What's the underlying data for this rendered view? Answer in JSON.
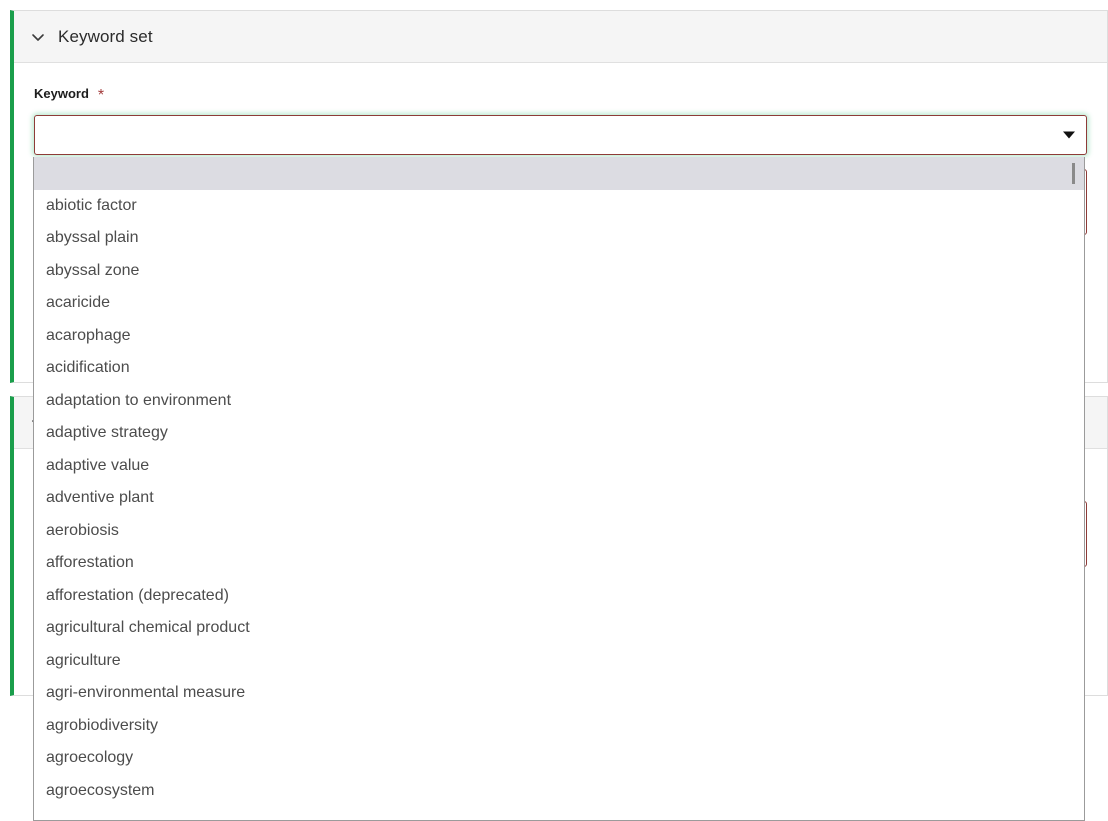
{
  "panels": [
    {
      "title": "Keyword set",
      "collapse_icon": "chevron-down-icon",
      "field": {
        "label": "Keyword",
        "required_marker": "*",
        "value": "",
        "placeholder": "",
        "dropdown_icon": "triangle-down-icon"
      }
    },
    {
      "title": "",
      "collapse_icon": "chevron-down-icon"
    }
  ],
  "dropdown": {
    "selected_index": 0,
    "options": [
      "",
      "abiotic factor",
      "abyssal plain",
      "abyssal zone",
      "acaricide",
      "acarophage",
      "acidification",
      "adaptation to environment",
      "adaptive strategy",
      "adaptive value",
      "adventive plant",
      "aerobiosis",
      "afforestation",
      "afforestation (deprecated)",
      "agricultural chemical product",
      "agriculture",
      "agri-environmental measure",
      "agrobiodiversity",
      "agroecology",
      "agroecosystem"
    ]
  },
  "colors": {
    "accent_green": "#1a9e4b",
    "field_border_red": "#8e3b38",
    "required_star": "#a33c3c",
    "option_selected_bg": "#dcdce2",
    "header_bg": "#f5f5f5"
  }
}
